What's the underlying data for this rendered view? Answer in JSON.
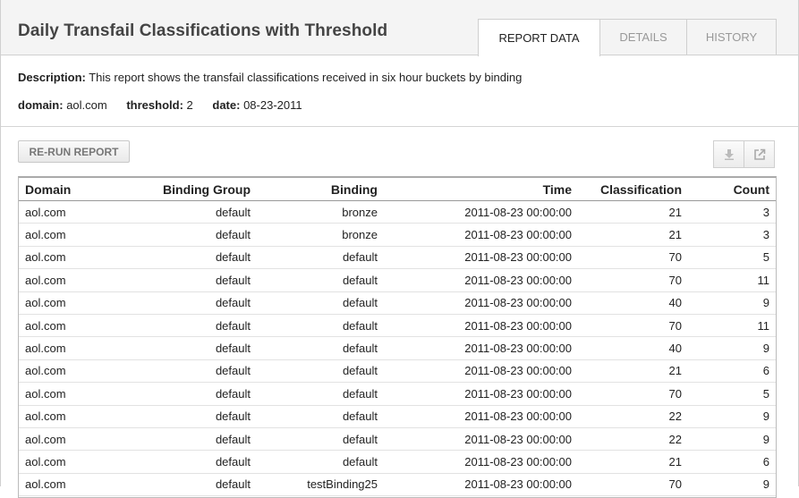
{
  "report": {
    "title": "Daily Transfail Classifications with Threshold",
    "tabs": [
      {
        "label": "REPORT DATA",
        "active": true
      },
      {
        "label": "DETAILS",
        "active": false
      },
      {
        "label": "HISTORY",
        "active": false
      }
    ],
    "description_label": "Description:",
    "description_text": "This report shows the transfail classifications received in six hour buckets by binding",
    "params": [
      {
        "label": "domain:",
        "value": "aol.com"
      },
      {
        "label": "threshold:",
        "value": "2"
      },
      {
        "label": "date:",
        "value": "08-23-2011"
      }
    ],
    "rerun_label": "RE-RUN REPORT",
    "icons": [
      "download-icon",
      "external-link-icon"
    ]
  },
  "table": {
    "columns": [
      "Domain",
      "Binding Group",
      "Binding",
      "Time",
      "Classification",
      "Count"
    ],
    "rows": [
      [
        "aol.com",
        "default",
        "bronze",
        "2011-08-23 00:00:00",
        "21",
        "3"
      ],
      [
        "aol.com",
        "default",
        "bronze",
        "2011-08-23 00:00:00",
        "21",
        "3"
      ],
      [
        "aol.com",
        "default",
        "default",
        "2011-08-23 00:00:00",
        "70",
        "5"
      ],
      [
        "aol.com",
        "default",
        "default",
        "2011-08-23 00:00:00",
        "70",
        "11"
      ],
      [
        "aol.com",
        "default",
        "default",
        "2011-08-23 00:00:00",
        "40",
        "9"
      ],
      [
        "aol.com",
        "default",
        "default",
        "2011-08-23 00:00:00",
        "70",
        "11"
      ],
      [
        "aol.com",
        "default",
        "default",
        "2011-08-23 00:00:00",
        "40",
        "9"
      ],
      [
        "aol.com",
        "default",
        "default",
        "2011-08-23 00:00:00",
        "21",
        "6"
      ],
      [
        "aol.com",
        "default",
        "default",
        "2011-08-23 00:00:00",
        "70",
        "5"
      ],
      [
        "aol.com",
        "default",
        "default",
        "2011-08-23 00:00:00",
        "22",
        "9"
      ],
      [
        "aol.com",
        "default",
        "default",
        "2011-08-23 00:00:00",
        "22",
        "9"
      ],
      [
        "aol.com",
        "default",
        "default",
        "2011-08-23 00:00:00",
        "21",
        "6"
      ],
      [
        "aol.com",
        "default",
        "testBinding25",
        "2011-08-23 00:00:00",
        "70",
        "9"
      ]
    ]
  }
}
